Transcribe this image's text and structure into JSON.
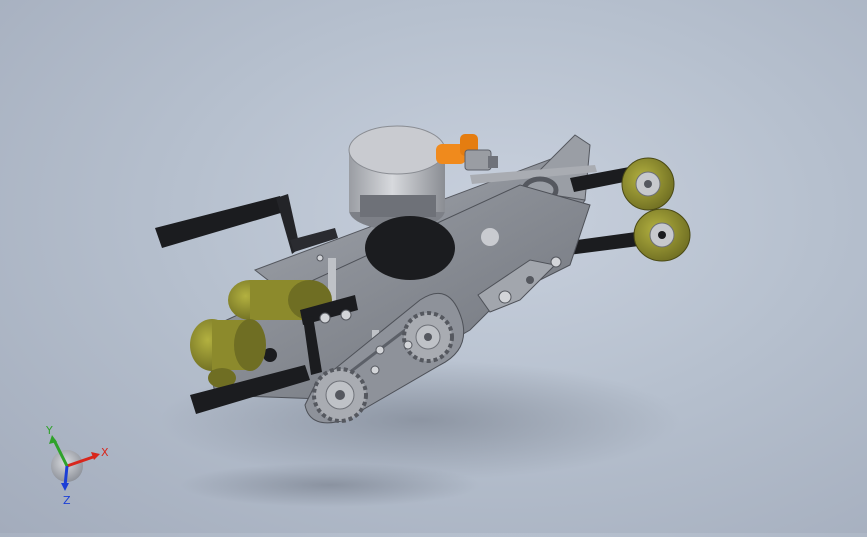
{
  "view": {
    "background_color": "#b6c0ce",
    "model_name": ""
  },
  "triad": {
    "x_label": "X",
    "y_label": "Y",
    "z_label": "Z",
    "x_color": "#d8261c",
    "y_color": "#2fa22a",
    "z_color": "#1c3fd6"
  },
  "colors": {
    "frame_gray": "#8e929a",
    "frame_dark": "#5c6068",
    "handle_black": "#1b1c1f",
    "roller_olive": "#8c8a2c",
    "motor_silver": "#b5b8be",
    "fitting_orange": "#f08a1c"
  }
}
